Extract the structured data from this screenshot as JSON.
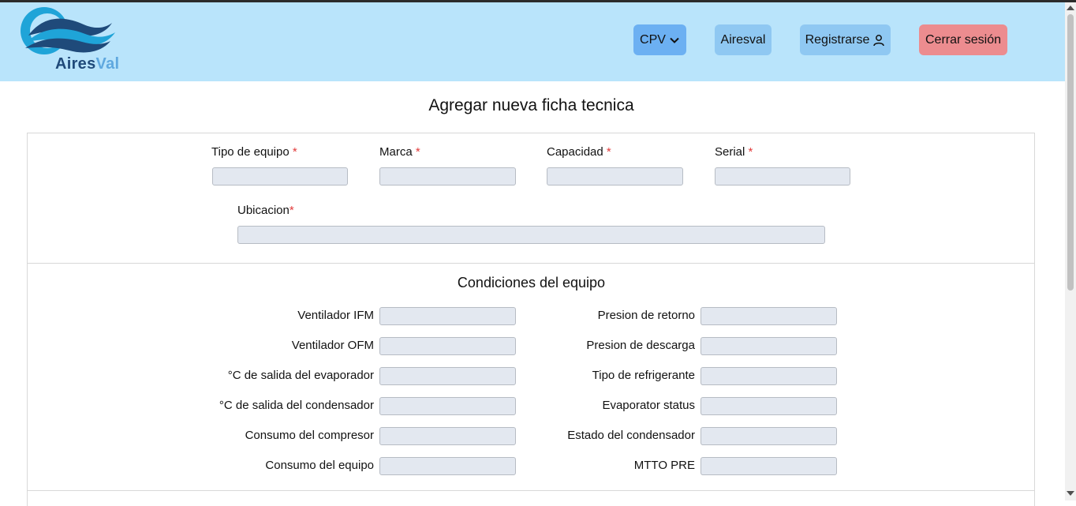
{
  "brand": {
    "name_part1": "Aires",
    "name_part2": "Val",
    "colors": {
      "dark": "#1f4a7a",
      "light": "#5fa8df",
      "navbar": "#b9e4fb"
    }
  },
  "nav": {
    "cpv_label": "CPV",
    "airesval_label": "Airesval",
    "register_label": "Registrarse",
    "logout_label": "Cerrar sesión",
    "icons": {
      "cpv": "chevron-down-icon",
      "register": "user-icon"
    }
  },
  "page": {
    "title": "Agregar nueva ficha tecnica"
  },
  "form": {
    "required_mark": "*",
    "tipo_equipo": "Tipo de equipo",
    "marca": "Marca",
    "capacidad": "Capacidad",
    "serial": "Serial",
    "ubicacion": "Ubicacion"
  },
  "conditions": {
    "title": "Condiciones del equipo",
    "left": [
      "Ventilador IFM",
      "Ventilador OFM",
      "°C de salida del evaporador",
      "°C de salida del condensador",
      "Consumo del compresor",
      "Consumo del equipo"
    ],
    "right": [
      "Presion de retorno",
      "Presion de descarga",
      "Tipo de refrigerante",
      "Evaporator status",
      "Estado del condensador",
      "MTTO PRE"
    ]
  }
}
